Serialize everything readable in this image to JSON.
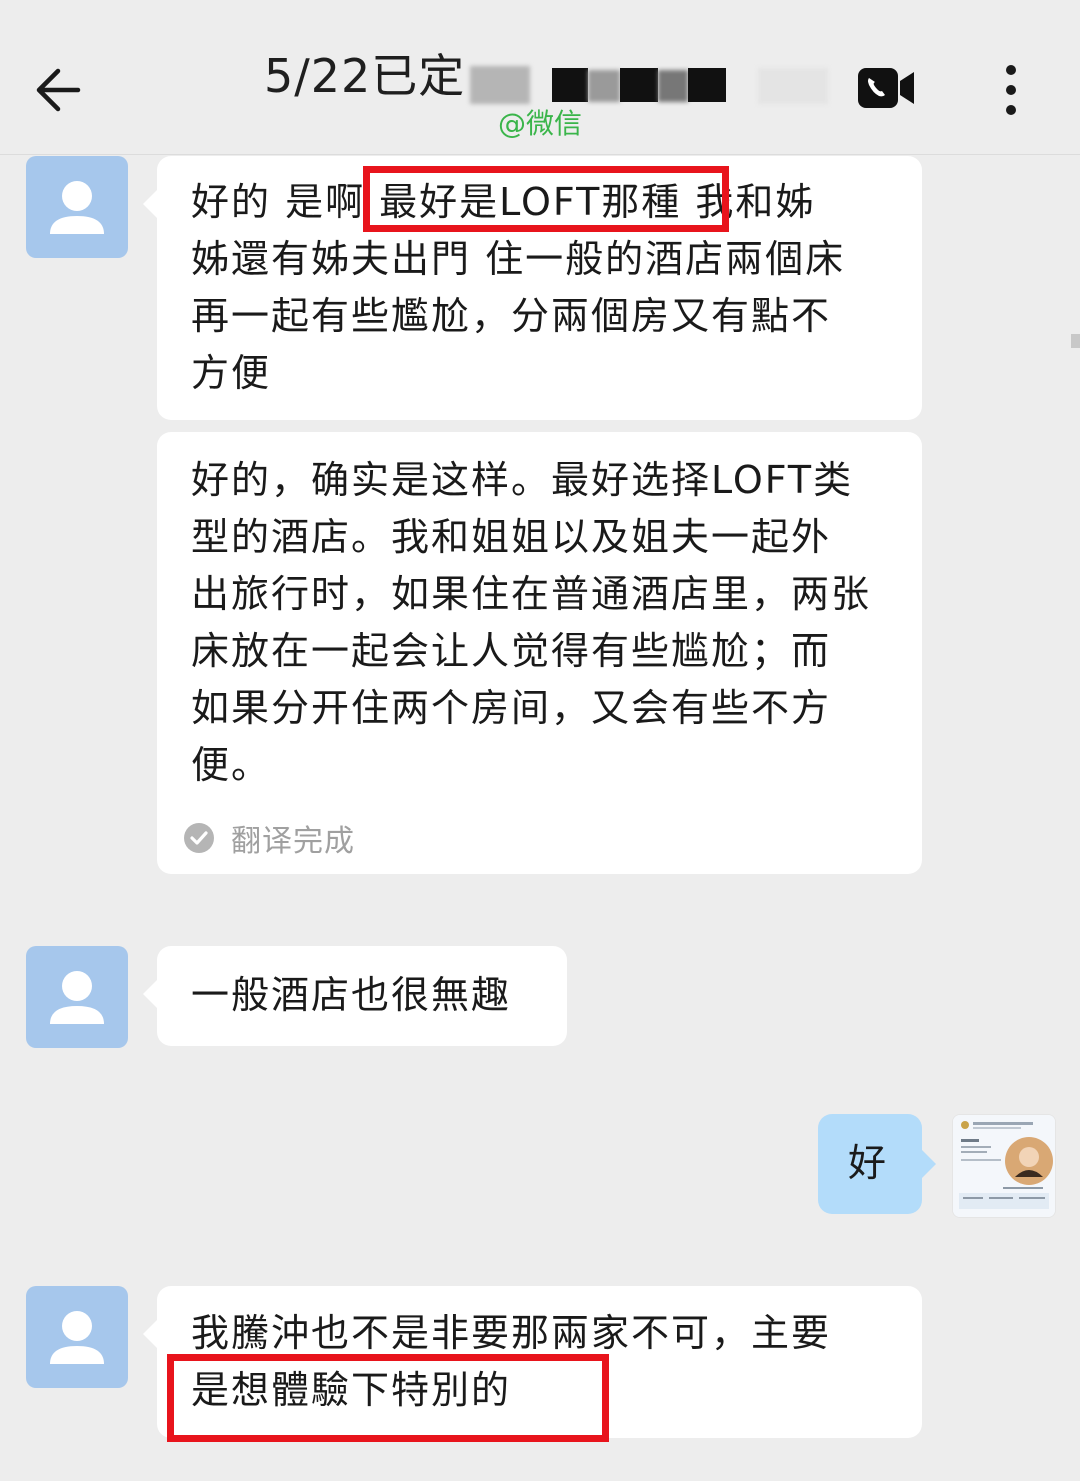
{
  "header": {
    "title": "5/22已定",
    "watermark": "@微信",
    "back_icon": "arrow-left-icon",
    "call_icon": "video-call-icon",
    "menu_icon": "more-vertical-icon"
  },
  "messages": [
    {
      "sender": "contact",
      "text": "好的 是啊 最好是LOFT那種 我和姊\n姊還有姊夫出門 住一般的酒店兩個床\n再一起有些尷尬，分兩個房又有點不\n方便",
      "translation": "好的，确实是这样。最好选择LOFT类\n型的酒店。我和姐姐以及姐夫一起外\n出旅行时，如果住在普通酒店里，两张\n床放在一起会让人觉得有些尴尬；而\n如果分开住两个房间，又会有些不方\n便。",
      "translation_status": "翻译完成",
      "highlight": "最好是LOFT那種"
    },
    {
      "sender": "contact",
      "text": "一般酒店也很無趣"
    },
    {
      "sender": "me",
      "text": "好"
    },
    {
      "sender": "contact",
      "text": "我騰沖也不是非要那兩家不可，主要\n是想體驗下特別的",
      "highlight": "是想體驗下特別的"
    }
  ],
  "colors": {
    "background": "#ededed",
    "bubble_contact": "#ffffff",
    "bubble_me": "#b3dcfa",
    "avatar_default": "#a6c7ec",
    "highlight_box": "#e8141c",
    "watermark": "#3ab54a"
  }
}
